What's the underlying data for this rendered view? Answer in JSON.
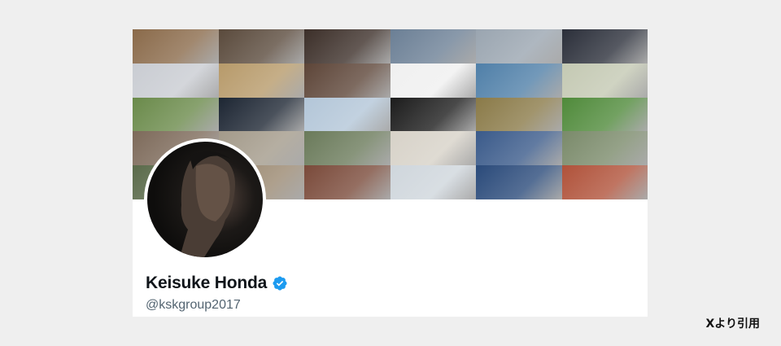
{
  "profile": {
    "display_name": "Keisuke Honda",
    "handle": "@kskgroup2017",
    "verified": true,
    "verified_icon": "verified-badge-icon",
    "verified_color": "#1d9bf0"
  },
  "banner": {
    "description_icon": "photo-collage",
    "tile_colors": [
      "#8a6a4a",
      "#5a4a3c",
      "#3c2f29",
      "#6b7f95",
      "#9aa5b0",
      "#2b2f3a",
      "#c9ccd2",
      "#b79a6a",
      "#5d4538",
      "#f0f0f0",
      "#4f7fa8",
      "#c4c9b3",
      "#6a8a4a",
      "#1d2633",
      "#b3c6d8",
      "#1c1c1c",
      "#8a7a48",
      "#4f8a3a",
      "#7d6a5a",
      "#a39a8a",
      "#6a7a5a",
      "#d7d2c8",
      "#3a5a8a",
      "#7a8a6a",
      "#5a6a4a",
      "#9a8870",
      "#7a4a3a",
      "#cfd6dc",
      "#2a4a7a",
      "#b0523a"
    ]
  },
  "caption": {
    "credit": "Xより引用"
  }
}
